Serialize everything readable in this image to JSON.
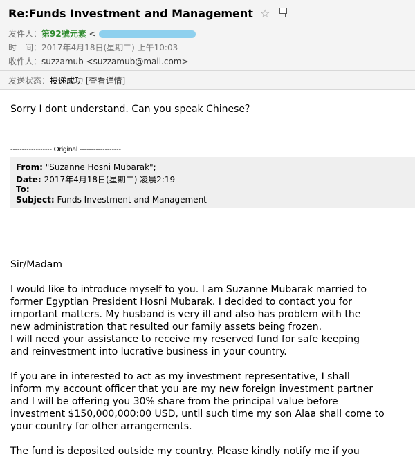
{
  "email": {
    "subject": "Re:Funds Investment and Management",
    "from_label": "发件人：",
    "from_name": "第92號元素",
    "from_open": "<",
    "time_label": "时　间：",
    "time_value": "2017年4月18日(星期二) 上午10:03",
    "to_label": "收件人：",
    "to_value": "suzzamub <suzzamub@mail.com>",
    "status_label": "发送状态：",
    "status_value": "投递成功",
    "status_detail": "[查看详情]"
  },
  "reply": {
    "text": "Sorry I dont understand. Can you speak Chinese？"
  },
  "original": {
    "separator": "------------------ Original ------------------",
    "from_key": "From:",
    "from_val": "\"Suzanne Hosni Mubarak\";",
    "date_key": "Date:",
    "date_val": "2017年4月18日(星期二) 凌晨2:19",
    "to_key": "To:",
    "to_val": "",
    "subject_key": "Subject:",
    "subject_val": "Funds Investment and Management"
  },
  "body": {
    "greeting": "Sir/Madam",
    "p1": [
      "I would like to introduce myself to you. I am Suzanne Mubarak married to",
      "former Egyptian President Hosni Mubarak. I decided to contact you for",
      "important matters. My husband is very ill and also has problem with the",
      "new administration that resulted our family assets being frozen.",
      "I will need your assistance to receive my reserved fund for safe keeping",
      "and reinvestment into lucrative business in your country."
    ],
    "p2": [
      "If you are in interested to act as my investment representative, I shall",
      "inform my account officer that you are my new foreign investment partner",
      "and I will be offering you 30% share from the principal value before",
      "investment $150,000,000:00 USD, until such time my son Alaa shall come to",
      "your country for other arrangements."
    ],
    "p3": [
      "The fund is deposited outside my country. Please kindly notify me if you"
    ]
  }
}
